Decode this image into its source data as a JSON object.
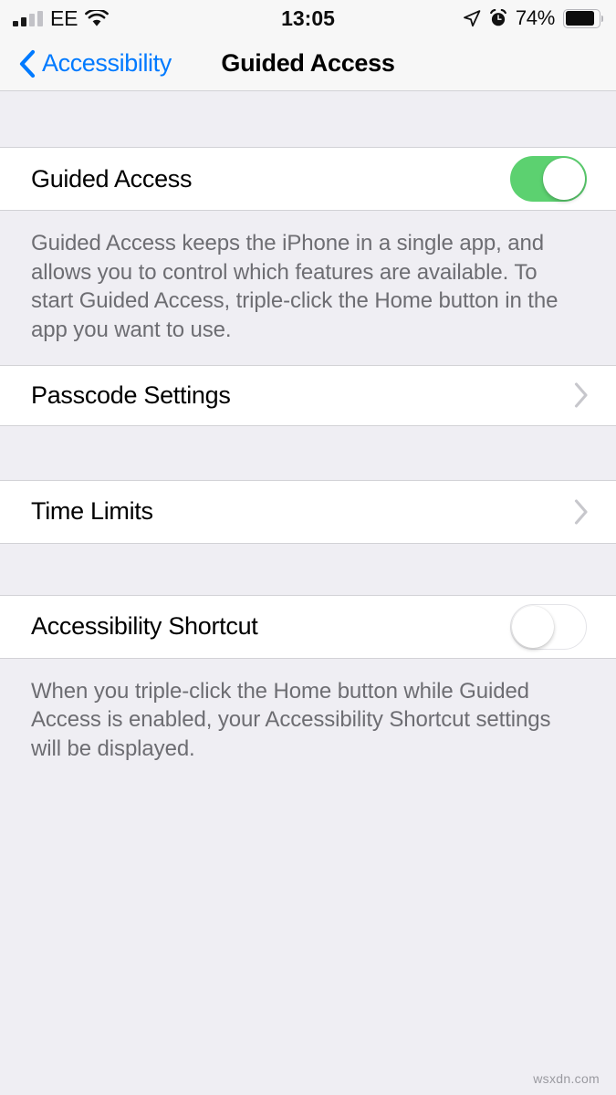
{
  "status_bar": {
    "carrier": "EE",
    "signal_bars_filled": 2,
    "signal_bars_total": 4,
    "wifi_icon": "wifi-icon",
    "time": "13:05",
    "location_icon": "location-arrow-icon",
    "alarm_icon": "alarm-clock-icon",
    "battery_percent": "74%",
    "battery_level": 74
  },
  "nav_bar": {
    "back_label": "Accessibility",
    "back_icon": "chevron-left-icon",
    "title": "Guided Access",
    "accent_color": "#007AFF"
  },
  "sections": {
    "guided_access": {
      "label": "Guided Access",
      "toggle_state": "on",
      "toggle_on_color": "#5CD170",
      "footer": "Guided Access keeps the iPhone in a single app, and allows you to control which features are available. To start Guided Access, triple-click the Home button in the app you want to use."
    },
    "passcode_settings": {
      "label": "Passcode Settings",
      "disclosure_icon": "chevron-right-icon"
    },
    "time_limits": {
      "label": "Time Limits",
      "disclosure_icon": "chevron-right-icon"
    },
    "accessibility_shortcut": {
      "label": "Accessibility Shortcut",
      "toggle_state": "off",
      "footer": "When you triple-click the Home button while Guided Access is enabled, your Accessibility Shortcut settings will be displayed."
    }
  },
  "watermark": "wsxdn.com"
}
